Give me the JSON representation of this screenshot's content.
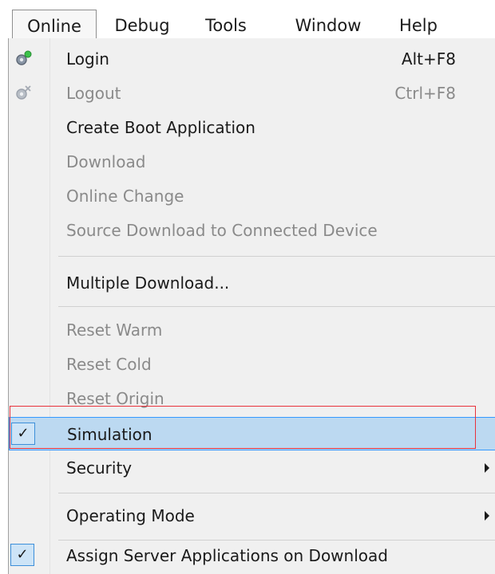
{
  "menubar": {
    "items": [
      "Online",
      "Debug",
      "Tools",
      "Window",
      "Help"
    ]
  },
  "menu": {
    "items": [
      {
        "label": "Login",
        "shortcut": "Alt+F8",
        "enabled": true,
        "icon": "login-gear-icon"
      },
      {
        "label": "Logout",
        "shortcut": "Ctrl+F8",
        "enabled": false,
        "icon": "logout-gear-icon"
      },
      {
        "label": "Create Boot Application",
        "enabled": true
      },
      {
        "label": "Download",
        "enabled": false
      },
      {
        "label": "Online Change",
        "enabled": false
      },
      {
        "label": "Source Download to Connected Device",
        "enabled": false
      },
      {
        "label": "Multiple Download...",
        "enabled": true
      },
      {
        "label": "Reset Warm",
        "enabled": false
      },
      {
        "label": "Reset Cold",
        "enabled": false
      },
      {
        "label": "Reset Origin",
        "enabled": false
      },
      {
        "label": "Simulation",
        "enabled": true,
        "checked": true,
        "highlighted": true
      },
      {
        "label": "Security",
        "enabled": true,
        "submenu": true
      },
      {
        "label": "Operating Mode",
        "enabled": true,
        "submenu": true
      },
      {
        "label": "Assign Server Applications on Download",
        "enabled": true,
        "checked": true
      }
    ],
    "check_mark": "✓"
  },
  "colors": {
    "highlight": "#bcd9f1",
    "highlight_border": "#3399ff",
    "annotation_box": "#e8323c",
    "disabled_text": "#8a8a8a"
  }
}
